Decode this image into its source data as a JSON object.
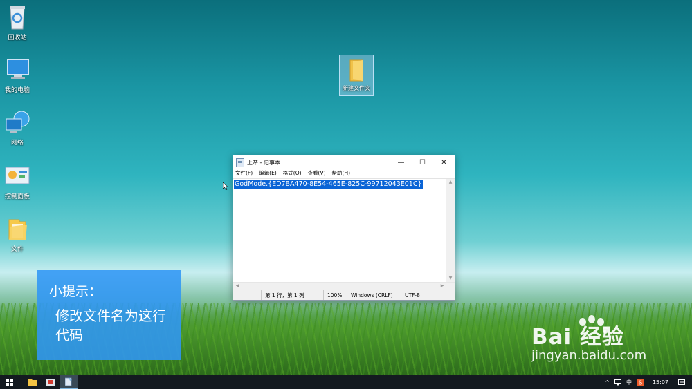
{
  "desktop": {
    "icons": [
      {
        "label": "回收站"
      },
      {
        "label": "我的电脑"
      },
      {
        "label": "网络"
      },
      {
        "label": "控制面板"
      },
      {
        "label": "文件"
      },
      {
        "label": "新建文件夹"
      }
    ]
  },
  "notepad": {
    "title": "上帝 - 记事本",
    "controls": {
      "minimize": "—",
      "maximize": "☐",
      "close": "✕"
    },
    "menu": [
      "文件(F)",
      "编辑(E)",
      "格式(O)",
      "查看(V)",
      "帮助(H)"
    ],
    "content": "GodMode.{ED7BA470-8E54-465E-825C-99712043E01C}",
    "status": {
      "position": "第 1 行，第 1 列",
      "zoom": "100%",
      "line_ending": "Windows (CRLF)",
      "encoding": "UTF-8"
    }
  },
  "tip": {
    "heading": "小提示：",
    "body": "修改文件名为这行代码"
  },
  "watermark": {
    "logo": "Bai 经验",
    "url": "jingyan.baidu.com"
  },
  "taskbar": {
    "tray": {
      "ime": "中",
      "time": "15:07"
    }
  },
  "colors": {
    "selection": "#0a64d6",
    "tip_panel": "#3096f5",
    "taskbar": "#141a20"
  }
}
